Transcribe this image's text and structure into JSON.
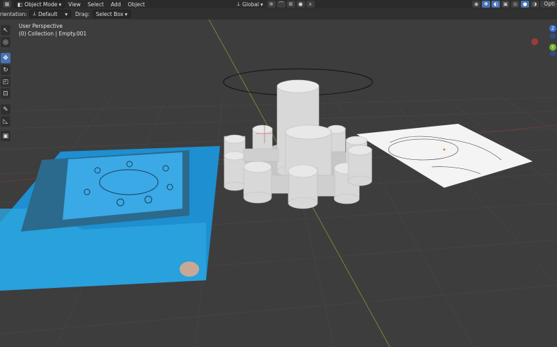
{
  "header": {
    "mode_label": "Object Mode",
    "menus": [
      "View",
      "Select",
      "Add",
      "Object"
    ],
    "transform_orientation": "Global",
    "options_label": "Opti"
  },
  "tool_settings": {
    "orientation_label": "rientation:",
    "orientation_value": "Default",
    "drag_label": "Drag:",
    "drag_value": "Select Box"
  },
  "viewport": {
    "view_name": "User Perspective",
    "collection_info": "(0) Collection | Empty.001"
  },
  "toolbar": {
    "tools": [
      "select-box",
      "cursor",
      "move",
      "rotate",
      "scale",
      "transform",
      "annotate",
      "measure",
      "add-cube"
    ],
    "active_tool": "move"
  },
  "gizmo": {
    "axes": [
      "Z",
      "Y",
      "X"
    ]
  },
  "colors": {
    "accent": "#4772b3",
    "x_axis": "#cc3b3b",
    "y_axis": "#78b32d",
    "z_axis": "#3a74d6",
    "grid": "#474747"
  }
}
